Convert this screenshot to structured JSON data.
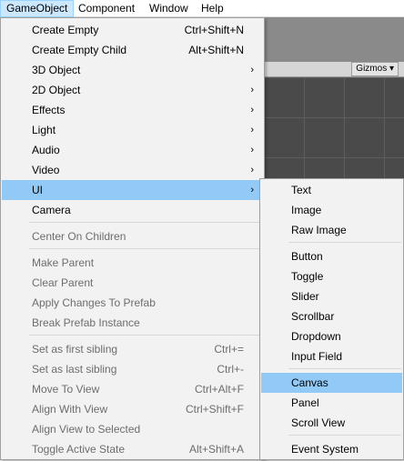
{
  "menubar": {
    "items": [
      {
        "label": "GameObject"
      },
      {
        "label": "Component"
      },
      {
        "label": "Window"
      },
      {
        "label": "Help"
      }
    ]
  },
  "editor": {
    "gizmos_label": "Gizmos ▾"
  },
  "main_menu": {
    "create_empty": {
      "label": "Create Empty",
      "shortcut": "Ctrl+Shift+N"
    },
    "create_empty_child": {
      "label": "Create Empty Child",
      "shortcut": "Alt+Shift+N"
    },
    "object_3d": {
      "label": "3D Object",
      "arrow": "›"
    },
    "object_2d": {
      "label": "2D Object",
      "arrow": "›"
    },
    "effects": {
      "label": "Effects",
      "arrow": "›"
    },
    "light": {
      "label": "Light",
      "arrow": "›"
    },
    "audio": {
      "label": "Audio",
      "arrow": "›"
    },
    "video": {
      "label": "Video",
      "arrow": "›"
    },
    "ui": {
      "label": "UI",
      "arrow": "›"
    },
    "camera": {
      "label": "Camera"
    },
    "center_on_children": {
      "label": "Center On Children"
    },
    "make_parent": {
      "label": "Make Parent"
    },
    "clear_parent": {
      "label": "Clear Parent"
    },
    "apply_changes_to_prefab": {
      "label": "Apply Changes To Prefab"
    },
    "break_prefab_instance": {
      "label": "Break Prefab Instance"
    },
    "set_first_sibling": {
      "label": "Set as first sibling",
      "shortcut": "Ctrl+="
    },
    "set_last_sibling": {
      "label": "Set as last sibling",
      "shortcut": "Ctrl+-"
    },
    "move_to_view": {
      "label": "Move To View",
      "shortcut": "Ctrl+Alt+F"
    },
    "align_with_view": {
      "label": "Align With View",
      "shortcut": "Ctrl+Shift+F"
    },
    "align_view_to_selected": {
      "label": "Align View to Selected"
    },
    "toggle_active_state": {
      "label": "Toggle Active State",
      "shortcut": "Alt+Shift+A"
    }
  },
  "ui_submenu": {
    "text": {
      "label": "Text"
    },
    "image": {
      "label": "Image"
    },
    "raw_image": {
      "label": "Raw Image"
    },
    "button": {
      "label": "Button"
    },
    "toggle": {
      "label": "Toggle"
    },
    "slider": {
      "label": "Slider"
    },
    "scrollbar": {
      "label": "Scrollbar"
    },
    "dropdown": {
      "label": "Dropdown"
    },
    "input_field": {
      "label": "Input Field"
    },
    "canvas": {
      "label": "Canvas"
    },
    "panel": {
      "label": "Panel"
    },
    "scroll_view": {
      "label": "Scroll View"
    },
    "event_system": {
      "label": "Event System"
    }
  },
  "colors": {
    "highlight": "#91c9f7",
    "menubar_open": "#cce8ff",
    "disabled_text": "#6d6d6d",
    "menu_bg": "#f2f2f2"
  }
}
